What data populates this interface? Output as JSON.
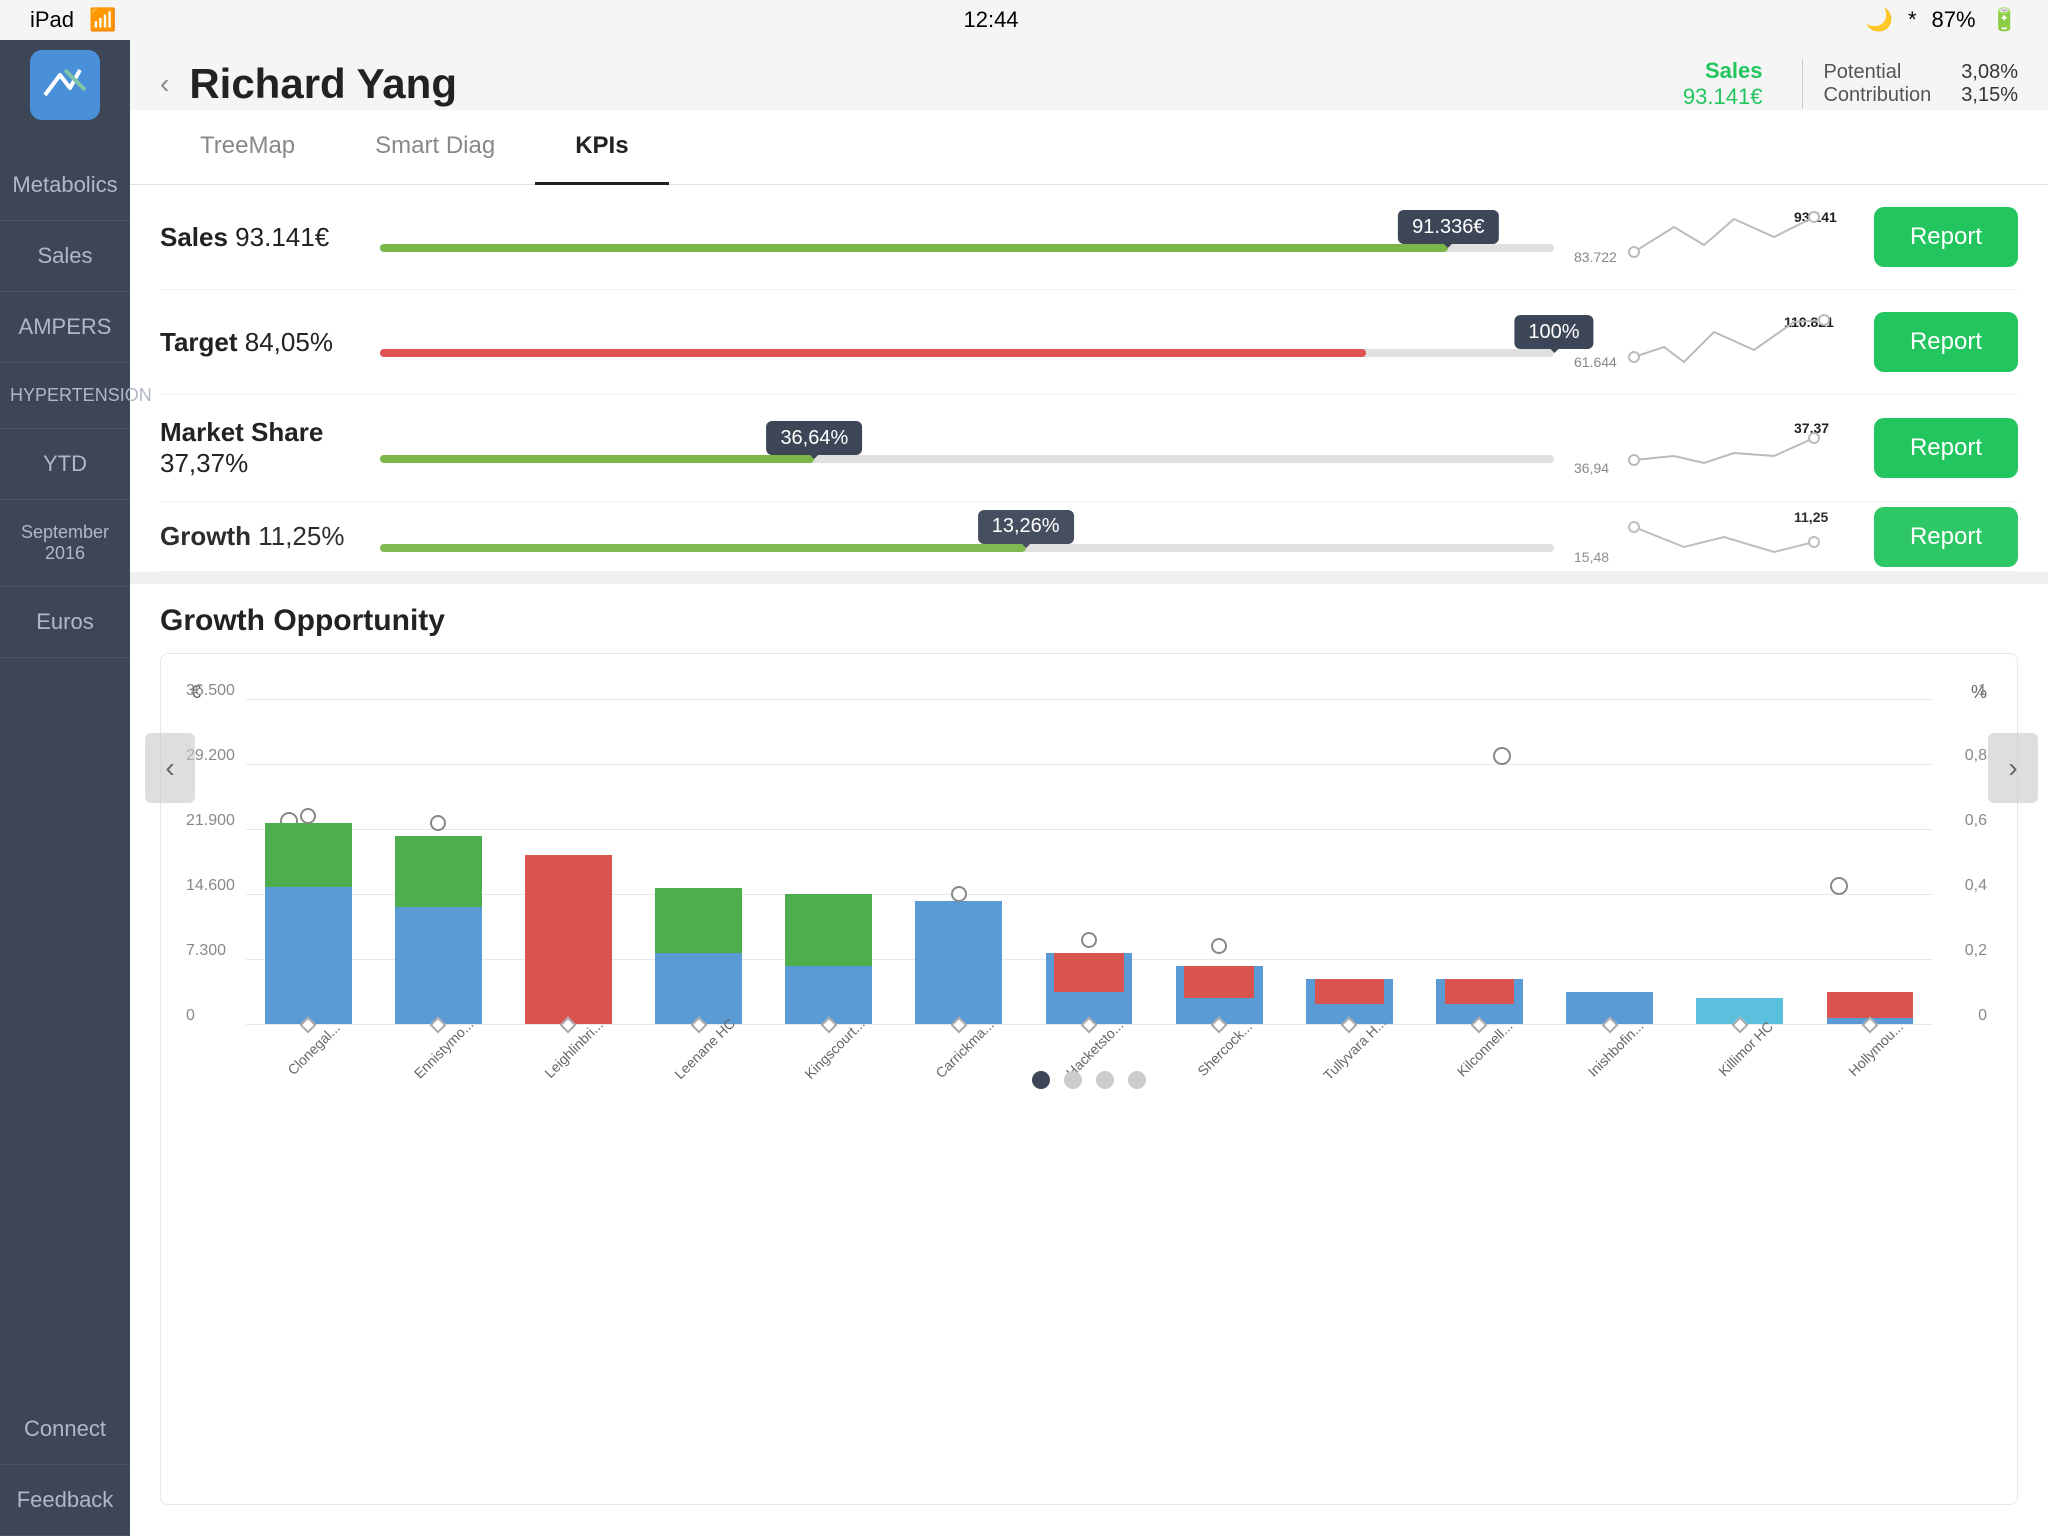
{
  "statusBar": {
    "carrier": "iPad",
    "time": "12:44",
    "battery": "87%"
  },
  "sidebar": {
    "items": [
      {
        "id": "metabolics",
        "label": "Metabolics"
      },
      {
        "id": "sales",
        "label": "Sales"
      },
      {
        "id": "ampers",
        "label": "AMPERS"
      },
      {
        "id": "hypertension",
        "label": "HYPERTENSION"
      },
      {
        "id": "ytd",
        "label": "YTD"
      },
      {
        "id": "september2016",
        "label": "September 2016"
      },
      {
        "id": "euros",
        "label": "Euros"
      }
    ],
    "bottomItems": [
      {
        "id": "connect",
        "label": "Connect"
      },
      {
        "id": "feedback",
        "label": "Feedback"
      }
    ]
  },
  "header": {
    "backLabel": "‹",
    "title": "Richard Yang",
    "salesLabel": "Sales",
    "salesValue": "93.141€",
    "potentialLabel": "Potential",
    "potentialValue": "3,08%",
    "contributionLabel": "Contribution",
    "contributionValue": "3,15%"
  },
  "tabs": [
    {
      "id": "treemap",
      "label": "TreeMap",
      "active": false
    },
    {
      "id": "smartdiag",
      "label": "Smart Diag",
      "active": false
    },
    {
      "id": "kpis",
      "label": "KPIs",
      "active": true
    }
  ],
  "kpis": [
    {
      "name": "Sales",
      "value": "93.141€",
      "badge": "91.336€",
      "barPercent": 91,
      "barColor": "green",
      "chartMin": "83.722",
      "chartMax": "93.141",
      "finalValue": "93.141",
      "reportLabel": "Report"
    },
    {
      "name": "Target",
      "value": "84,05%",
      "badge": "100%",
      "barPercent": 84,
      "barColor": "red",
      "chartMin": "61.644",
      "chartMax": "110.821",
      "finalValue": "110.821",
      "reportLabel": "Report"
    },
    {
      "name": "Market Share",
      "value": "37,37%",
      "badge": "36,64%",
      "barPercent": 37,
      "barColor": "green",
      "chartMin": "36,94",
      "chartMax": "37,37",
      "finalValue": "37,37",
      "reportLabel": "Report"
    },
    {
      "name": "Growth",
      "value": "11,25%",
      "badge": "13,26%",
      "barPercent": 55,
      "barColor": "green",
      "chartMin": "15,48",
      "chartMax": "11,25",
      "finalValue": "11,25",
      "reportLabel": "Report"
    }
  ],
  "growthOpportunity": {
    "title": "Growth Opportunity",
    "yLabelLeft": "€",
    "yLabelRight": "%",
    "gridLines": [
      {
        "label": "36.500",
        "labelRight": "1",
        "percent": 100
      },
      {
        "label": "29.200",
        "labelRight": "0,8",
        "percent": 80
      },
      {
        "label": "21.900",
        "labelRight": "0,6",
        "percent": 60
      },
      {
        "label": "14.600",
        "labelRight": "0,4",
        "percent": 40
      },
      {
        "label": "7.300",
        "labelRight": "0,2",
        "percent": 20
      },
      {
        "label": "0",
        "labelRight": "0",
        "percent": 0
      }
    ],
    "bars": [
      {
        "name": "Clonegal...",
        "blue": 62,
        "green": 20,
        "red": 0,
        "dotY": 58,
        "diamondY": 88
      },
      {
        "name": "Ennistymo...",
        "blue": 58,
        "green": 22,
        "red": 0,
        "dotY": 45,
        "diamondY": 88
      },
      {
        "name": "Leighlinbri...",
        "blue": 0,
        "green": 0,
        "red": 52,
        "dotY": 0,
        "diamondY": 88
      },
      {
        "name": "Leenane HC",
        "blue": 42,
        "green": 20,
        "red": 0,
        "dotY": 0,
        "diamondY": 88
      },
      {
        "name": "Kingscourt...",
        "blue": 40,
        "green": 22,
        "red": 0,
        "dotY": 0,
        "diamondY": 88
      },
      {
        "name": "Carrickma...",
        "blue": 38,
        "green": 0,
        "red": 0,
        "dotY": 60,
        "diamondY": 88
      },
      {
        "name": "Hacketsto...",
        "blue": 14,
        "green": 0,
        "red": 12,
        "dotY": 74,
        "diamondY": 88
      },
      {
        "name": "Shercock...",
        "blue": 12,
        "green": 0,
        "red": 10,
        "dotY": 74,
        "diamondY": 88
      },
      {
        "name": "Tullyvara H...",
        "blue": 10,
        "green": 0,
        "red": 8,
        "dotY": 0,
        "diamondY": 88
      },
      {
        "name": "Kilconnell...",
        "blue": 10,
        "green": 0,
        "red": 8,
        "dotY": 0,
        "diamondY": 88
      },
      {
        "name": "Inishbofin...",
        "blue": 8,
        "green": 0,
        "red": 0,
        "dotY": 0,
        "diamondY": 88
      },
      {
        "name": "Killimor HC",
        "blue": 6,
        "green": 0,
        "red": 0,
        "dotY": 0,
        "diamondY": 88
      },
      {
        "name": "Hollymou...",
        "blue": 8,
        "green": 0,
        "red": 8,
        "dotY": 0,
        "diamondY": 88
      }
    ],
    "dotLine29200": true,
    "dotLine14600": true
  },
  "navArrows": {
    "left": "‹",
    "right": "›"
  }
}
